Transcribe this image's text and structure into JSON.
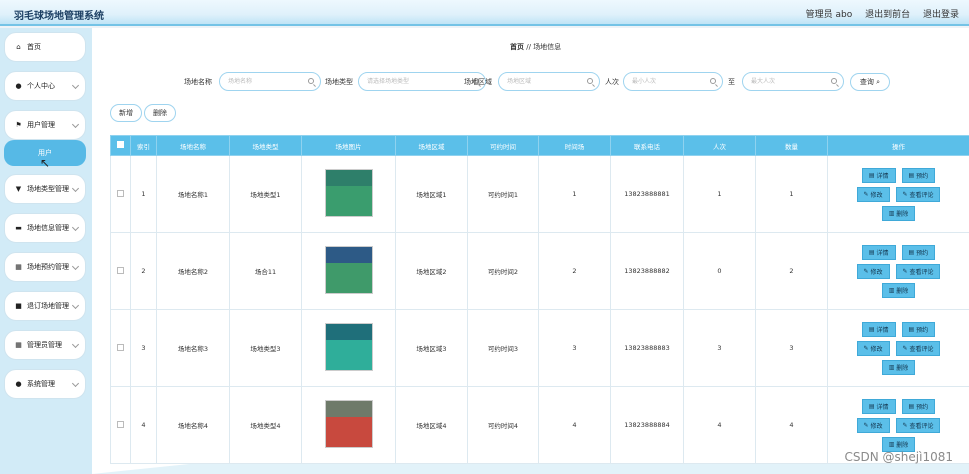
{
  "app": {
    "title": "羽毛球场地管理系统"
  },
  "topbar": {
    "user_label": "管理员 abo",
    "front_link": "退出到前台",
    "logout_link": "退出登录"
  },
  "sidebar": {
    "items": [
      {
        "icon": "home-icon",
        "glyph": "⌂",
        "label": "首页"
      },
      {
        "icon": "user-icon",
        "glyph": "●",
        "label": "个人中心"
      },
      {
        "icon": "flag-icon",
        "glyph": "⚑",
        "label": "用户管理"
      },
      {
        "icon": "shield-icon",
        "glyph": "▼",
        "label": "场地类型管理"
      },
      {
        "icon": "card-icon",
        "glyph": "▬",
        "label": "场地信息管理"
      },
      {
        "icon": "grid-icon",
        "glyph": "▦",
        "label": "场地预约管理"
      },
      {
        "icon": "lock-icon",
        "glyph": "■",
        "label": "退订场地管理"
      },
      {
        "icon": "grid-icon",
        "glyph": "▦",
        "label": "管理员管理"
      },
      {
        "icon": "person-icon",
        "glyph": "●",
        "label": "系统管理"
      }
    ],
    "sub_item": "用户"
  },
  "breadcrumb": {
    "home": "首页",
    "sep": "//",
    "current": "场地信息"
  },
  "filters": {
    "name_label": "场地名称",
    "name_placeholder": "场地名称",
    "type_label": "场地类型",
    "type_placeholder": "请选择场地类型",
    "area_label": "场地区域",
    "area_placeholder": "场地区域",
    "people_label": "人次",
    "min_placeholder": "最小人次",
    "to_label": "至",
    "max_placeholder": "最大人次",
    "search_button": "查询"
  },
  "actions": {
    "add": "新增",
    "delete": "删除"
  },
  "table": {
    "headers": [
      "",
      "索引",
      "场地名称",
      "场地类型",
      "场地图片",
      "场地区域",
      "可约时间",
      "时间场",
      "联系电话",
      "人次",
      "数量",
      "操作"
    ],
    "rows": [
      {
        "index": "1",
        "name": "场地名称1",
        "type": "场地类型1",
        "area": "场地区域1",
        "time": "可约时间1",
        "slot": "1",
        "phone": "13823888881",
        "people": "1",
        "qty": "1",
        "img_top": "#2e7f6a",
        "img_bottom": "#3a9d6e"
      },
      {
        "index": "2",
        "name": "场地名称2",
        "type": "场合11",
        "area": "场地区域2",
        "time": "可约时间2",
        "slot": "2",
        "phone": "13823888882",
        "people": "0",
        "qty": "2",
        "img_top": "#2d5a86",
        "img_bottom": "#3f9a6a"
      },
      {
        "index": "3",
        "name": "场地名称3",
        "type": "场地类型3",
        "area": "场地区域3",
        "time": "可约时间3",
        "slot": "3",
        "phone": "13823888883",
        "people": "3",
        "qty": "3",
        "img_top": "#1f6f7a",
        "img_bottom": "#2fae9a"
      },
      {
        "index": "4",
        "name": "场地名称4",
        "type": "场地类型4",
        "area": "场地区域4",
        "time": "可约时间4",
        "slot": "4",
        "phone": "13823888884",
        "people": "4",
        "qty": "4",
        "img_top": "#6e7a6a",
        "img_bottom": "#c8493e"
      }
    ],
    "ops": {
      "detail": "详情",
      "reserve": "预约",
      "edit": "修改",
      "review": "查看评论",
      "delete": "删除"
    }
  },
  "watermark": "CSDN @shejì1081",
  "colors": {
    "accent": "#5bbfe9",
    "topbar_border": "#74c3e6",
    "sidebar_bg": "#d2ebf7"
  }
}
